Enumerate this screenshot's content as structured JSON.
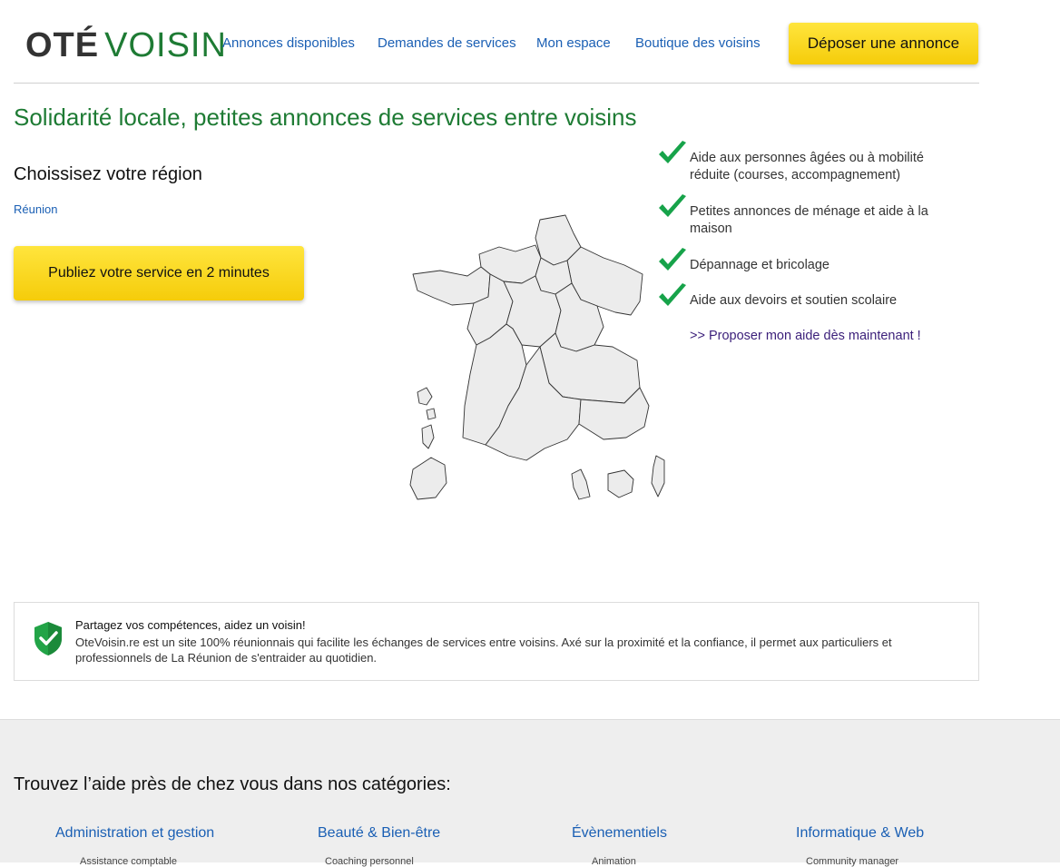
{
  "header": {
    "logo_ote": "OTÉ",
    "logo_voisin": "VOISIN",
    "nav": [
      "Annonces disponibles",
      "Demandes de services",
      "Mon espace",
      "Boutique des voisins"
    ],
    "cta": "Déposer une annonce"
  },
  "main": {
    "title": "Solidarité locale, petites annonces de services entre voisins",
    "region_heading": "Choissisez votre région",
    "region_link": "Réunion",
    "publish_button": "Publiez votre service en 2 minutes"
  },
  "features": [
    "Aide aux personnes âgées ou à mobilité réduite (courses, accompagnement)",
    "Petites annonces de ménage et aide à la maison",
    "Dépannage et bricolage",
    "Aide aux devoirs et soutien scolaire"
  ],
  "propose_link": ">> Proposer mon aide dès maintenant !",
  "info": {
    "title": "Partagez vos compétences, aidez un voisin!",
    "text": "OteVoisin.re est un site 100% réunionnais qui facilite les échanges de services entre voisins. Axé sur la proximité et la confiance, il permet aux particuliers et professionnels de La Réunion de s'entraider au quotidien."
  },
  "footer": {
    "title": "Trouvez l’aide près de chez vous dans nos catégories:",
    "categories": [
      "Administration et gestion",
      "Beauté & Bien-être",
      "Évènementiels",
      "Informatique & Web"
    ],
    "subitems": [
      "Assistance comptable",
      "Coaching personnel",
      "Animation",
      "Community manager"
    ]
  },
  "colors": {
    "brand_green": "#1e7b34",
    "link_blue": "#1a5fb4",
    "cta_yellow": "#fbd920",
    "check_green": "#17a34a"
  }
}
